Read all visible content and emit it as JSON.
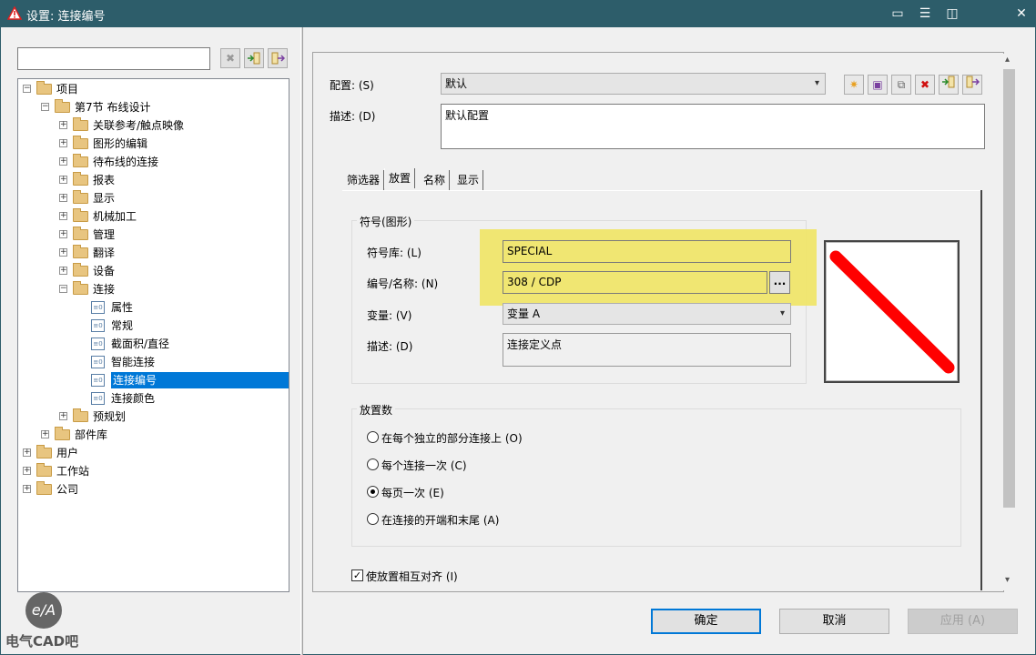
{
  "window": {
    "title": "设置: 连接编号"
  },
  "left": {
    "tree": [
      {
        "label": "项目",
        "level": 0,
        "type": "folder",
        "expanded": true
      },
      {
        "label": "第7节 布线设计",
        "level": 1,
        "type": "folder",
        "expanded": true
      },
      {
        "label": "关联参考/触点映像",
        "level": 2,
        "type": "folder"
      },
      {
        "label": "图形的编辑",
        "level": 2,
        "type": "folder"
      },
      {
        "label": "待布线的连接",
        "level": 2,
        "type": "folder"
      },
      {
        "label": "报表",
        "level": 2,
        "type": "folder"
      },
      {
        "label": "显示",
        "level": 2,
        "type": "folder"
      },
      {
        "label": "机械加工",
        "level": 2,
        "type": "folder"
      },
      {
        "label": "管理",
        "level": 2,
        "type": "folder"
      },
      {
        "label": "翻译",
        "level": 2,
        "type": "folder"
      },
      {
        "label": "设备",
        "level": 2,
        "type": "folder"
      },
      {
        "label": "连接",
        "level": 2,
        "type": "folder",
        "expanded": true
      },
      {
        "label": "属性",
        "level": 3,
        "type": "leaf"
      },
      {
        "label": "常规",
        "level": 3,
        "type": "leaf"
      },
      {
        "label": "截面积/直径",
        "level": 3,
        "type": "leaf"
      },
      {
        "label": "智能连接",
        "level": 3,
        "type": "leaf"
      },
      {
        "label": "连接编号",
        "level": 3,
        "type": "leaf",
        "selected": true
      },
      {
        "label": "连接颜色",
        "level": 3,
        "type": "leaf"
      },
      {
        "label": "预规划",
        "level": 2,
        "type": "folder"
      },
      {
        "label": "部件库",
        "level": 1,
        "type": "folder"
      },
      {
        "label": "用户",
        "level": 0,
        "type": "folder"
      },
      {
        "label": "工作站",
        "level": 0,
        "type": "folder"
      },
      {
        "label": "公司",
        "level": 0,
        "type": "folder"
      }
    ],
    "watermark": "电气CAD吧",
    "watermark_logo": "e/A"
  },
  "config": {
    "label": "配置: (S)",
    "value": "默认",
    "desc_label": "描述: (D)",
    "desc_value": "默认配置"
  },
  "tabs": [
    "筛选器",
    "放置",
    "名称",
    "显示"
  ],
  "symbol_group": {
    "title": "符号(图形)",
    "lib_label": "符号库: (L)",
    "lib_value": "SPECIAL",
    "num_label": "编号/名称: (N)",
    "num_value": "308 / CDP",
    "browse": "...",
    "var_label": "变量: (V)",
    "var_value": "变量 A",
    "desc_label": "描述: (D)",
    "desc_value": "连接定义点"
  },
  "placement_group": {
    "title": "放置数",
    "options": [
      {
        "label": "在每个独立的部分连接上 (O)",
        "checked": false
      },
      {
        "label": "每个连接一次 (C)",
        "checked": false
      },
      {
        "label": "每页一次 (E)",
        "checked": true
      },
      {
        "label": "在连接的开端和末尾 (A)",
        "checked": false
      }
    ]
  },
  "align_check": {
    "label": "使放置相互对齐 (I)",
    "checked": true
  },
  "buttons": {
    "ok": "确定",
    "cancel": "取消",
    "apply": "应用 (A)"
  },
  "colors": {
    "titlebar": "#2d5d6a",
    "selection": "#0078d7",
    "highlight": "#efe56a",
    "preview_line": "#ff0000"
  }
}
